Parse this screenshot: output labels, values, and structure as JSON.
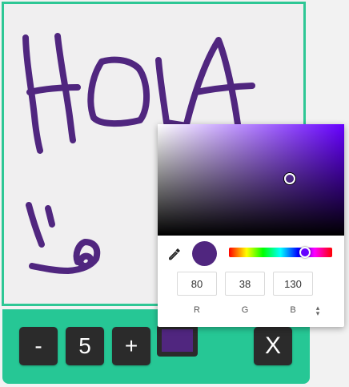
{
  "canvas": {
    "stroke_color": "#50267f",
    "border_color": "#2ec795",
    "background_color": "#f0eff0"
  },
  "toolbar": {
    "background_color": "#26c795",
    "decrease_label": "-",
    "brush_size": "5",
    "increase_label": "+",
    "close_label": "X",
    "current_color": "#50267f"
  },
  "color_picker": {
    "hue_color": "#6600ff",
    "hue_fraction": 0.74,
    "saturation": 0.71,
    "value": 0.51,
    "preview_color": "#50267f",
    "dropper_icon": "eyedropper-icon",
    "rgb": {
      "r": "80",
      "g": "38",
      "b": "130"
    },
    "labels": {
      "r": "R",
      "g": "G",
      "b": "B"
    },
    "mode_toggle_icon": "up-down-arrows-icon"
  }
}
